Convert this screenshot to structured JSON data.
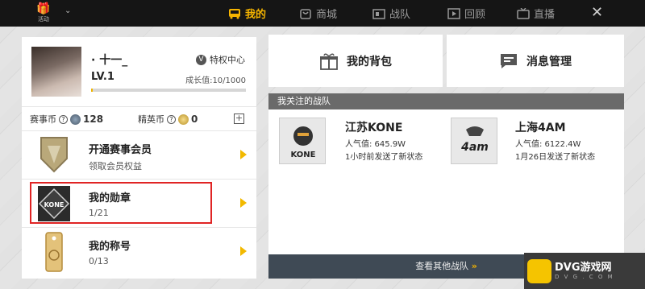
{
  "topbar": {
    "activity_label": "活动",
    "active_tab": "我的",
    "tabs": [
      "商城",
      "战队",
      "回顾",
      "直播"
    ]
  },
  "profile": {
    "username": "· 十一_",
    "level": "LV.1",
    "privilege": "特权中心",
    "growth": "成长值:10/1000",
    "growth_progress": 0.01
  },
  "coins": {
    "event_coin_label": "赛事币",
    "event_coin_value": "128",
    "elite_coin_label": "精英币",
    "elite_coin_value": "0"
  },
  "menu": [
    {
      "title": "开通赛事会员",
      "sub": "领取会员权益"
    },
    {
      "title": "我的勋章",
      "sub": "1/21"
    },
    {
      "title": "我的称号",
      "sub": "0/13"
    }
  ],
  "buttons": {
    "backpack": "我的背包",
    "messages": "消息管理"
  },
  "teams": {
    "header": "我关注的战队",
    "more": "查看其他战队",
    "list": [
      {
        "name": "江苏KONE",
        "pop": "人气值:  645.9W",
        "status": "1小时前发送了新状态",
        "logo_text": "KONE"
      },
      {
        "name": "上海4AM",
        "pop": "人气值:  6122.4W",
        "status": "1月26日发送了新状态",
        "logo_text": "4am"
      }
    ]
  },
  "watermark": {
    "title": "DVG游戏网",
    "sub": "D V G . C O M"
  },
  "colors": {
    "accent": "#f5b400",
    "highlight": "#e02424"
  }
}
